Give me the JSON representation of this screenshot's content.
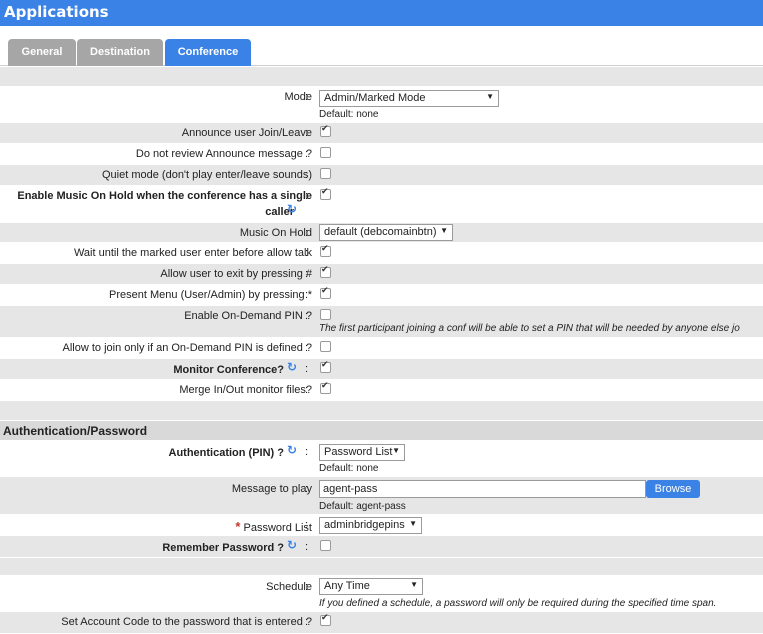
{
  "window": {
    "title": "Applications"
  },
  "tabs": [
    {
      "label": "General"
    },
    {
      "label": "Destination"
    },
    {
      "label": "Conference"
    }
  ],
  "conference": {
    "mode": {
      "label": "Mode",
      "value": "Admin/Marked Mode",
      "default": "Default: none"
    },
    "announce": {
      "label": "Announce user Join/Leave",
      "checked": true
    },
    "no_review": {
      "label": "Do not review Announce message ?",
      "checked": false
    },
    "quiet": {
      "label": "Quiet mode (don't play enter/leave sounds)",
      "checked": false
    },
    "moh_single": {
      "label_line1": "Enable Music On Hold when the conference has a single",
      "label_line2": "caller",
      "checked": true
    },
    "moh": {
      "label": "Music On Hold",
      "value": "default (debcomainbtn)"
    },
    "wait_marked": {
      "label": "Wait until the marked user enter before allow talk",
      "checked": true
    },
    "exit_hash": {
      "label": "Allow user to exit by pressing #",
      "checked": true
    },
    "present_menu": {
      "label": "Present Menu (User/Admin) by pressing *",
      "checked": true
    },
    "on_demand_pin": {
      "label": "Enable On-Demand PIN ?",
      "checked": false,
      "hint": "The first participant joining a conf will be able to set a PIN that will be needed by anyone else jo"
    },
    "join_if_pin": {
      "label": "Allow to join only if an On-Demand PIN is defined ?",
      "checked": false
    },
    "monitor": {
      "label": "Monitor Conference?",
      "checked": true
    },
    "merge_monitor": {
      "label": "Merge In/Out monitor files?",
      "checked": true
    }
  },
  "auth": {
    "section_title": "Authentication/Password",
    "auth_pin": {
      "label": "Authentication (PIN) ?",
      "value": "Password List",
      "default": "Default: none"
    },
    "message": {
      "label": "Message to play",
      "value": "agent-pass",
      "browse_label": "Browse",
      "default": "Default: agent-pass"
    },
    "password_list": {
      "required_mark": "*",
      "label": "Password List",
      "value": "adminbridgepins"
    },
    "remember": {
      "label": "Remember Password ?",
      "checked": false
    },
    "schedule": {
      "label": "Schedule",
      "value": "Any Time",
      "hint": "If you defined a schedule, a password will only be required during the specified time span."
    },
    "account_code": {
      "label": "Set Account Code to the password that is entered ?",
      "checked": true
    }
  },
  "icons": {
    "refresh": "refresh-icon",
    "dropdown": "chevron-down-icon",
    "checkbox_mark": "check-icon"
  },
  "colors": {
    "accent": "#3b82e6",
    "row_gray": "#e6e6e6",
    "section": "#d9d9d9",
    "required": "#c0392b"
  }
}
